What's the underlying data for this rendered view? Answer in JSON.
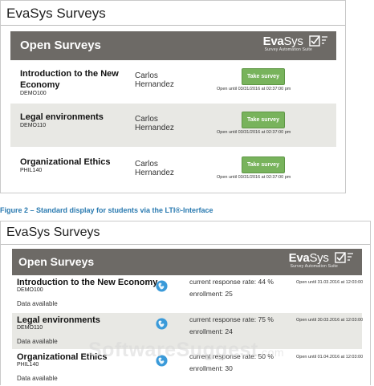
{
  "top_shot": {
    "app_title": "EvaSys Surveys",
    "panel_title": "Open Surveys",
    "logo": {
      "word_bold": "Eva",
      "word_rest": "Sys",
      "tagline": "Survey Automation Suite"
    },
    "rows": [
      {
        "course": "Introduction to the New Economy",
        "code": "DEMO100",
        "teacher": "Carlos Hernandez",
        "button": "Take survey",
        "open_until": "Open until 03/31/2016 at 02:37:00 pm"
      },
      {
        "course": "Legal environments",
        "code": "DEMO110",
        "teacher": "Carlos Hernandez",
        "button": "Take survey",
        "open_until": "Open until 03/31/2016 at 02:37:00 pm"
      },
      {
        "course": "Organizational Ethics",
        "code": "PHIL140",
        "teacher": "Carlos Hernandez",
        "button": "Take survey",
        "open_until": "Open until 03/31/2016 at 02:37:00 pm"
      }
    ]
  },
  "caption": "Figure 2 – Standard display for students via the LTI®-Interface",
  "bottom_shot": {
    "app_title": "EvaSys Surveys",
    "panel_title": "Open Surveys",
    "logo": {
      "word_bold": "Eva",
      "word_rest": "Sys",
      "tagline": "Survey Automation Suite"
    },
    "watermark": "SoftwareSuggest",
    "watermark_suffix": ".com",
    "rows": [
      {
        "course": "Introduction to the New Economy",
        "code": "DEMO100",
        "status": "Data available",
        "response_rate": "current response rate: 44 %",
        "enrollment": "enrollment: 25",
        "open_until": "Open until 31.03.2016 at 12:03:00"
      },
      {
        "course": "Legal environments",
        "code": "DEMO110",
        "status": "Data available",
        "response_rate": "current response rate: 75 %",
        "enrollment": "enrollment: 24",
        "open_until": "Open until 30.03.2016 at 12:03:00"
      },
      {
        "course": "Organizational Ethics",
        "code": "PHIL140",
        "status": "Data available",
        "response_rate": "current response rate: 50 %",
        "enrollment": "enrollment: 30",
        "open_until": "Open until 01.04.2016 at 12:03:00"
      }
    ]
  },
  "colors": {
    "header_bg": "#6d6a66",
    "button_green": "#78b35c",
    "row_alt": "#e8e8e4",
    "caption_blue": "#2a7ab0",
    "globe_blue": "#3a9ad9"
  },
  "icons": {
    "logo_mark": "checkbox-icon",
    "globe": "globe-icon"
  }
}
